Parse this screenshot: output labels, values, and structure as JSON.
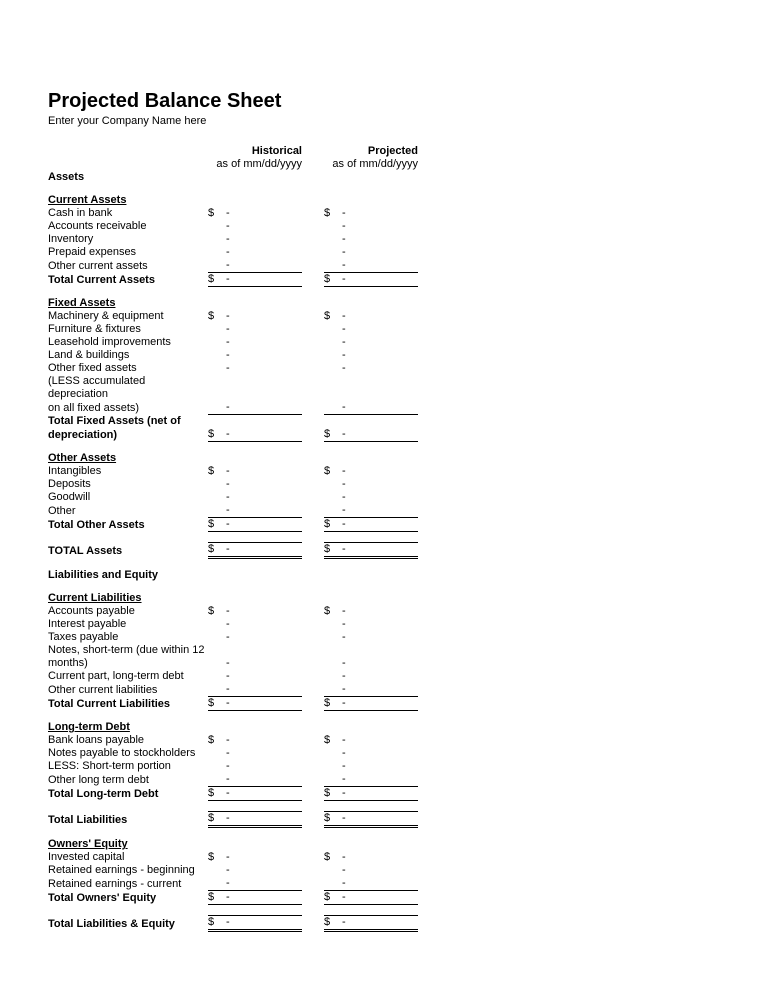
{
  "title": "Projected Balance Sheet",
  "subtitle": "Enter your Company Name here",
  "cols": {
    "hist_head": "Historical",
    "hist_sub": "as of mm/dd/yyyy",
    "proj_head": "Projected",
    "proj_sub": "as of mm/dd/yyyy"
  },
  "s": {
    "assets": "Assets",
    "cur_assets": "Current Assets",
    "cash": "Cash in bank",
    "ar": "Accounts receivable",
    "inv": "Inventory",
    "prepaid": "Prepaid expenses",
    "oca": "Other current assets",
    "tca": "Total Current Assets",
    "fixed": "Fixed Assets",
    "mach": "Machinery & equipment",
    "furn": "Furniture & fixtures",
    "lease": "Leasehold improvements",
    "land": "Land & buildings",
    "ofa": "Other fixed assets",
    "depr1": "(LESS accumulated depreciation",
    "depr2": "on all fixed assets)",
    "tfa1": "Total Fixed Assets (net of",
    "tfa2": "depreciation)",
    "other_assets": "Other Assets",
    "intan": "Intangibles",
    "dep": "Deposits",
    "good": "Goodwill",
    "oth": "Other",
    "toa": "Total Other Assets",
    "tot_assets": "TOTAL Assets",
    "liab_eq": "Liabilities and Equity",
    "cur_liab": "Current Liabilities",
    "ap": "Accounts payable",
    "ip": "Interest payable",
    "tp": "Taxes payable",
    "notes1": "Notes, short-term (due within 12",
    "notes2": "months)",
    "cpltd": "Current part, long-term debt",
    "ocl": "Other current liabilities",
    "tcl": "Total Current Liabilities",
    "ltd": "Long-term Debt",
    "bank": "Bank loans payable",
    "npst": "Notes payable to stockholders",
    "stp": "LESS: Short-term portion",
    "oltd": "Other long term debt",
    "tltd": "Total Long-term Debt",
    "tl": "Total Liabilities",
    "oe": "Owners' Equity",
    "inv_cap": "Invested capital",
    "reb": "Retained earnings - beginning",
    "rec": "Retained earnings - current",
    "toe": "Total Owners' Equity",
    "tle": "Total Liabilities & Equity"
  },
  "cur": "$",
  "dash": "-"
}
